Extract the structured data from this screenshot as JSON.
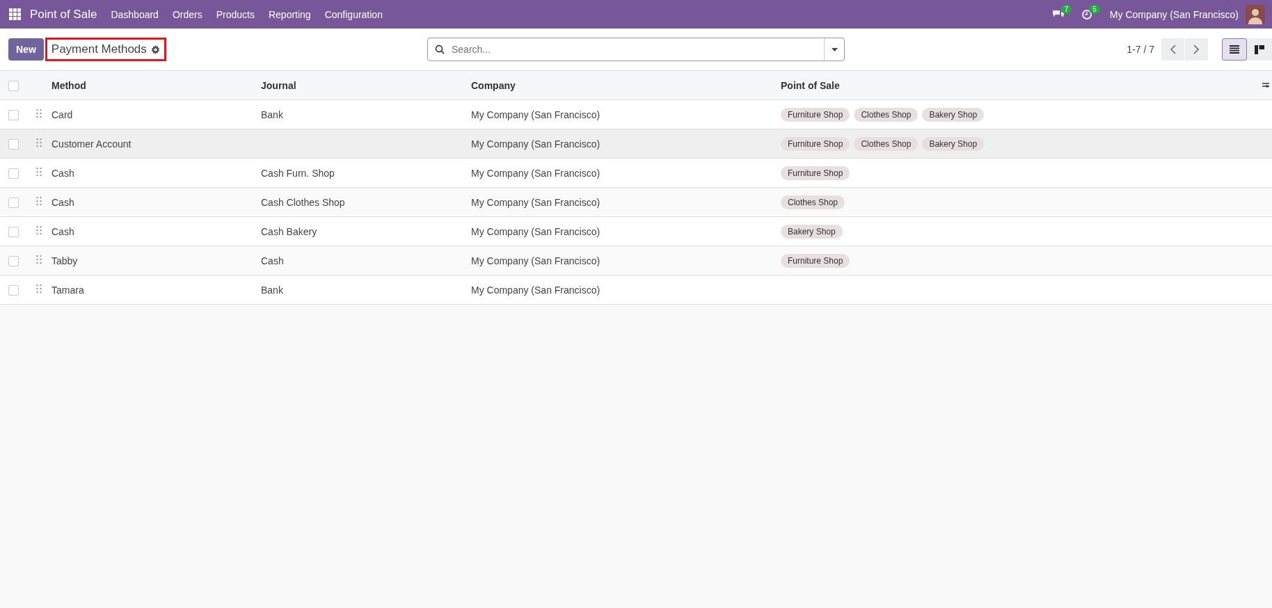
{
  "navbar": {
    "app_name": "Point of Sale",
    "menu": [
      "Dashboard",
      "Orders",
      "Products",
      "Reporting",
      "Configuration"
    ],
    "messages_count": "7",
    "activities_count": "5",
    "company": "My Company (San Francisco)"
  },
  "control_panel": {
    "new_button": "New",
    "breadcrumb": {
      "title": "Payment Methods",
      "highlighted": true
    },
    "search": {
      "placeholder": "Search..."
    },
    "pager": "1-7 / 7",
    "views": [
      {
        "kind": "list",
        "selected": true
      },
      {
        "kind": "kanban",
        "selected": false
      }
    ]
  },
  "table": {
    "select_all_checked": false,
    "columns": [
      "Method",
      "Journal",
      "Company",
      "Point of Sale"
    ],
    "rows": [
      {
        "method": "Card",
        "journal": "Bank",
        "company": "My Company (San Francisco)",
        "point_of_sale": [
          "Furniture Shop",
          "Clothes Shop",
          "Bakery Shop"
        ],
        "checked": false,
        "hovered": false
      },
      {
        "method": "Customer Account",
        "journal": "",
        "company": "My Company (San Francisco)",
        "point_of_sale": [
          "Furniture Shop",
          "Clothes Shop",
          "Bakery Shop"
        ],
        "checked": false,
        "hovered": true
      },
      {
        "method": "Cash",
        "journal": "Cash Furn. Shop",
        "company": "My Company (San Francisco)",
        "point_of_sale": [
          "Furniture Shop"
        ],
        "checked": false,
        "hovered": false
      },
      {
        "method": "Cash",
        "journal": "Cash Clothes Shop",
        "company": "My Company (San Francisco)",
        "point_of_sale": [
          "Clothes Shop"
        ],
        "checked": false,
        "hovered": false
      },
      {
        "method": "Cash",
        "journal": "Cash Bakery",
        "company": "My Company (San Francisco)",
        "point_of_sale": [
          "Bakery Shop"
        ],
        "checked": false,
        "hovered": false
      },
      {
        "method": "Tabby",
        "journal": "Cash",
        "company": "My Company (San Francisco)",
        "point_of_sale": [
          "Furniture Shop"
        ],
        "checked": false,
        "hovered": false
      },
      {
        "method": "Tamara",
        "journal": "Bank",
        "company": "My Company (San Francisco)",
        "point_of_sale": [],
        "checked": false,
        "hovered": false
      }
    ]
  }
}
